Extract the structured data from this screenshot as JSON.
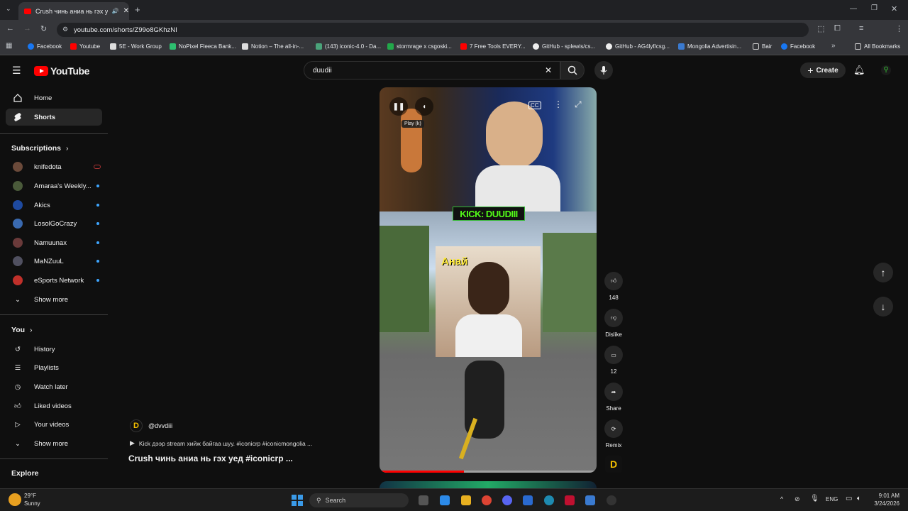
{
  "browser": {
    "tab_title": "Crush чинь аниа нь гэх уед",
    "url": "youtube.com/shorts/Z99o8GKhzNI",
    "bookmarks": [
      "Facebook",
      "Youtube",
      "5E - Work Group",
      "NoPixel Fleeca Bank...",
      "Notion – The all-in-...",
      "(143) iconic-4.0 - Da...",
      "stormrage x csgoski...",
      "7 Free Tools EVERY...",
      "GitHub - splewis/cs...",
      "GitHub - AG4lyf/csg...",
      "Mongolia Advertisin...",
      "Bair",
      "Facebook"
    ],
    "all_bookmarks_label": "All Bookmarks",
    "colors": {
      "tab_bg": "#35363a",
      "frame_bg": "#202124"
    }
  },
  "header": {
    "logo_text": "YouTube",
    "search_value": "duudii",
    "create_label": "Create"
  },
  "sidebar": {
    "home_label": "Home",
    "shorts_label": "Shorts",
    "subscriptions_heading": "Subscriptions",
    "subscriptions": [
      {
        "name": "knifedota",
        "status": "live",
        "color": "#6b4a3a"
      },
      {
        "name": "Amaraa's Weekly...",
        "status": "new",
        "color": "#4a5a3a"
      },
      {
        "name": "Akics",
        "status": "new",
        "color": "#1e4aa0"
      },
      {
        "name": "LosolGoCrazy",
        "status": "new",
        "color": "#3a6ab0"
      },
      {
        "name": "Namuunax",
        "status": "new",
        "color": "#6a3a3a"
      },
      {
        "name": "MaNZuuL",
        "status": "new",
        "color": "#505060"
      },
      {
        "name": "eSports Network",
        "status": "new",
        "color": "#c0302a"
      }
    ],
    "show_more_label": "Show more",
    "you_heading": "You",
    "you_items": [
      "History",
      "Playlists",
      "Watch later",
      "Liked videos",
      "Your videos"
    ],
    "show_more_label_2": "Show more",
    "explore_heading": "Explore"
  },
  "video": {
    "kick_overlay": "KICK: DUUDIII",
    "face_caption": "Анай",
    "tooltip": "Play (k)",
    "progress_fraction": 0.39
  },
  "actions": {
    "like_count": "148",
    "dislike_label": "Dislike",
    "comment_count": "12",
    "share_label": "Share",
    "remix_label": "Remix"
  },
  "caption": {
    "channel_handle": "@dvvdiii",
    "description": "Kick дээр stream хийж байгаа шуу. #iconicrp  #iconicmongolia  ...",
    "title": "Crush чинь аниа нь гэх уед #iconicrp ..."
  },
  "taskbar": {
    "weather_temp": "29°F",
    "weather_desc": "Sunny",
    "search_label": "Search",
    "language": "ENG",
    "time": "9:01 AM",
    "date": "3/24/2026"
  }
}
